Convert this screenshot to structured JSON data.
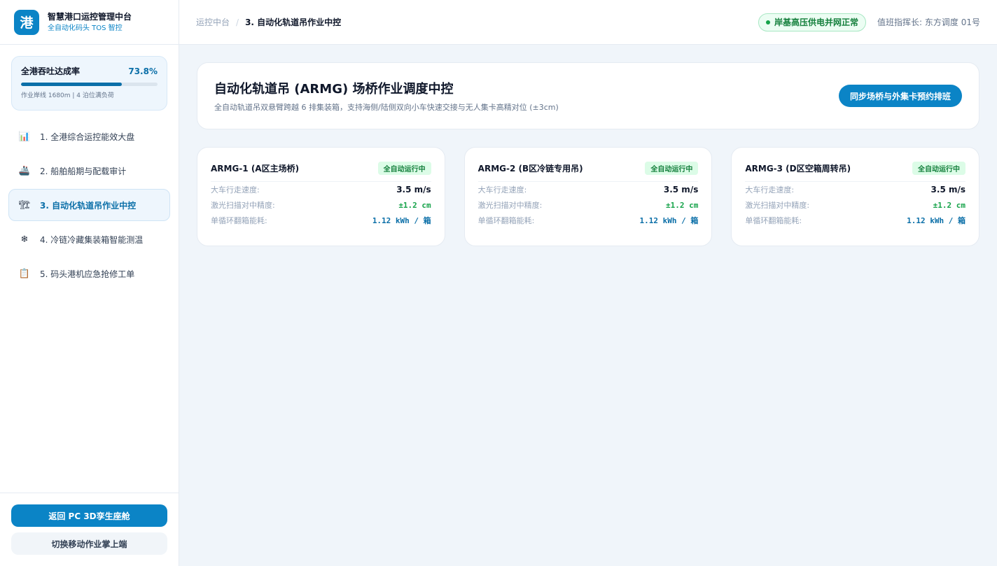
{
  "brand": {
    "logo_char": "港",
    "title": "智慧港口运控管理中台",
    "subtitle": "全自动化码头 TOS 智控"
  },
  "kpi": {
    "label": "全港吞吐达成率",
    "value": "73.8%",
    "progress_percent": 73.8,
    "note": "作业岸线 1680m | 4 泊位满负荷"
  },
  "nav": {
    "items": [
      {
        "icon": "bar-chart-icon",
        "glyph": "📊",
        "label": "1. 全港综合运控能效大盘",
        "active": false
      },
      {
        "icon": "ship-icon",
        "glyph": "🚢",
        "label": "2. 船舶船期与配载审计",
        "active": false
      },
      {
        "icon": "crane-icon",
        "glyph": "🏗",
        "label": "3. 自动化轨道吊作业中控",
        "active": true
      },
      {
        "icon": "snowflake-icon",
        "glyph": "❄",
        "label": "4. 冷链冷藏集装箱智能测温",
        "active": false
      },
      {
        "icon": "clipboard-icon",
        "glyph": "📋",
        "label": "5. 码头港机应急抢修工单",
        "active": false
      }
    ]
  },
  "footer": {
    "primary_label": "返回 PC 3D孪生座舱",
    "secondary_label": "切换移动作业掌上端"
  },
  "header": {
    "breadcrumb_root": "运控中台",
    "breadcrumb_sep": "/",
    "breadcrumb_current": "3. 自动化轨道吊作业中控",
    "status_text": "岸基高压供电并网正常",
    "duty_text": "值班指挥长: 东方调度 01号"
  },
  "hero": {
    "title": "自动化轨道吊 (ARMG) 场桥作业调度中控",
    "description": "全自动轨道吊双悬臂跨越 6 排集装箱，支持海侧/陆侧双向小车快速交接与无人集卡高精对位 (±3cm)",
    "button_label": "同步场桥与外集卡预约排班"
  },
  "cards": [
    {
      "title": "ARMG-1 (A区主场桥)",
      "badge": "全自动运行中",
      "rows": [
        {
          "label": "大车行走速度:",
          "value": "3.5 m/s"
        },
        {
          "label": "激光扫描对中精度:",
          "value": "±1.2 cm"
        },
        {
          "label": "单循环翻箱能耗:",
          "value": "1.12 kWh / 箱"
        }
      ]
    },
    {
      "title": "ARMG-2 (B区冷链专用吊)",
      "badge": "全自动运行中",
      "rows": [
        {
          "label": "大车行走速度:",
          "value": "3.5 m/s"
        },
        {
          "label": "激光扫描对中精度:",
          "value": "±1.2 cm"
        },
        {
          "label": "单循环翻箱能耗:",
          "value": "1.12 kWh / 箱"
        }
      ]
    },
    {
      "title": "ARMG-3 (D区空箱周转吊)",
      "badge": "全自动运行中",
      "rows": [
        {
          "label": "大车行走速度:",
          "value": "3.5 m/s"
        },
        {
          "label": "激光扫描对中精度:",
          "value": "±1.2 cm"
        },
        {
          "label": "单循环翻箱能耗:",
          "value": "1.12 kWh / 箱"
        }
      ]
    }
  ],
  "colors": {
    "accent": "#0b84c6",
    "success": "#16a34a",
    "background": "#f0f5fa"
  }
}
